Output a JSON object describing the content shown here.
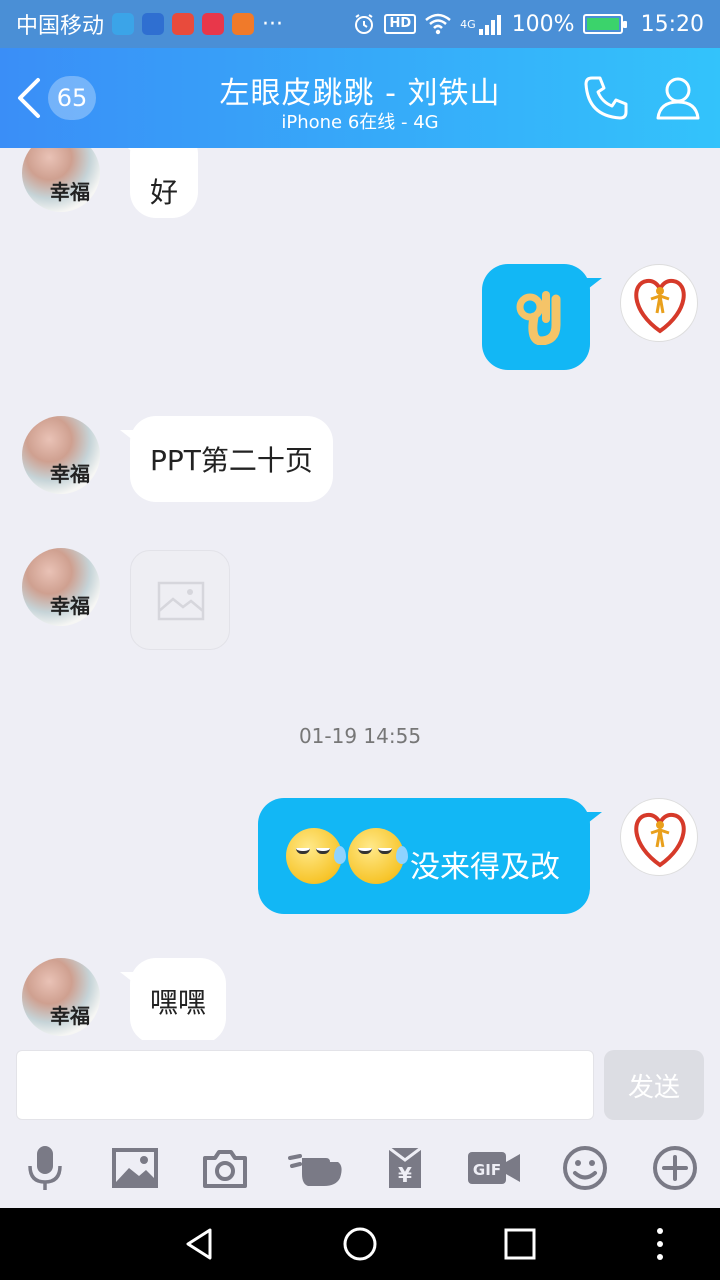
{
  "status_bar": {
    "carrier": "中国移动",
    "more": "···",
    "network": "4G",
    "hd": "HD",
    "battery": "100%",
    "time": "15:20"
  },
  "header": {
    "unread_count": "65",
    "title": "左眼皮跳跳 - 刘铁山",
    "subtitle": "iPhone 6在线 - 4G"
  },
  "messages": {
    "m1": "好",
    "m2_emoji": "ok-hand",
    "m3": "PPT第二十页",
    "timestamp": "01-19 14:55",
    "m5_text": "没来得及改",
    "m6": "嘿嘿"
  },
  "avatars": {
    "friend_caption": "幸福"
  },
  "input": {
    "value": "",
    "send_label": "发送"
  },
  "toolbar": {
    "gif_label": "GIF"
  },
  "colors": {
    "accent": "#12b7f5",
    "header_start": "#3a8ef7",
    "header_end": "#33c3fb",
    "background": "#eeeef5"
  }
}
